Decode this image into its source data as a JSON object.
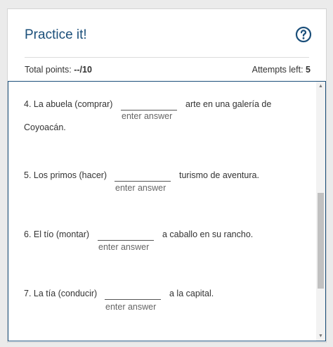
{
  "header": {
    "title": "Practice it!",
    "help_icon": "help-circle-icon",
    "accent_color": "#1b4f7a"
  },
  "stats": {
    "points_label": "Total points:",
    "points_value": "--/10",
    "attempts_label": "Attempts left:",
    "attempts_value": "5"
  },
  "questions": [
    {
      "prefix": "4. La abuela (comprar)",
      "suffix": "arte en una galería de",
      "continuation": "Coyoacán.",
      "placeholder": "enter answer"
    },
    {
      "prefix": "5. Los primos (hacer)",
      "suffix": "turismo de aventura.",
      "placeholder": "enter answer"
    },
    {
      "prefix": "6. El tío (montar)",
      "suffix": "a caballo en su rancho.",
      "placeholder": "enter answer"
    },
    {
      "prefix": "7. La tía (conducir)",
      "suffix": "a la capital.",
      "placeholder": "enter answer"
    }
  ],
  "scrollbar": {
    "up_icon": "triangle-up-icon",
    "down_icon": "triangle-down-icon"
  }
}
